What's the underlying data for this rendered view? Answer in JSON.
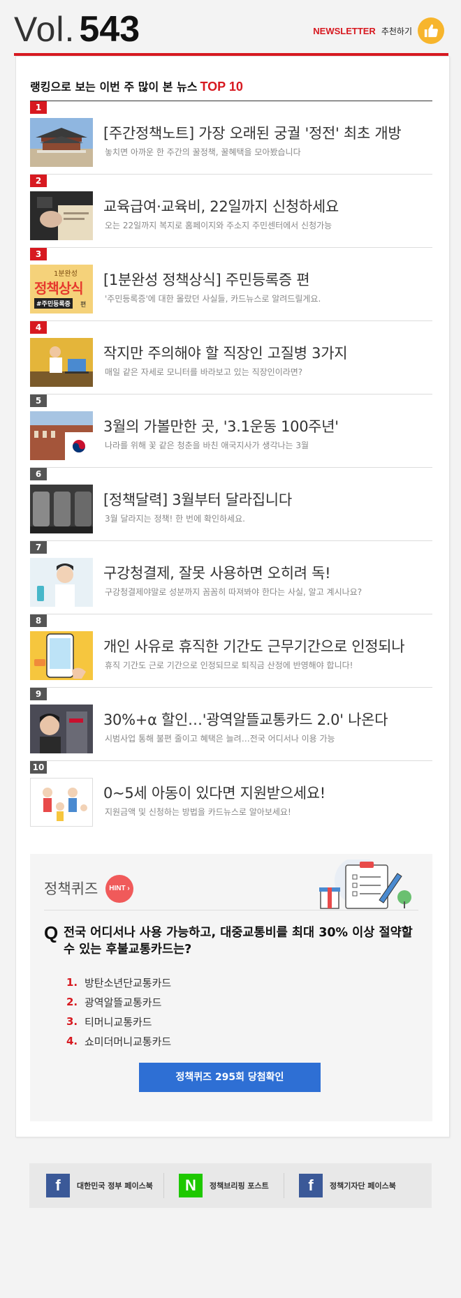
{
  "header": {
    "vol_label": "Vol.",
    "vol_number": "543",
    "newsletter_label": "NEWSLETTER",
    "recommend_label": "추천하기"
  },
  "ranking": {
    "title": "랭킹으로 보는 이번 주 많이 본 뉴스",
    "title_accent": "TOP 10",
    "items": [
      {
        "rank": "1",
        "title": "[주간정책노트] 가장 오래된 궁궐 '정전' 최초 개방",
        "subtitle": "놓치면 아까운 한 주간의 꿀정책, 꿀혜택을 모아봤습니다"
      },
      {
        "rank": "2",
        "title": "교육급여·교육비, 22일까지 신청하세요",
        "subtitle": "오는 22일까지 복지로 홈페이지와 주소지 주민센터에서 신청가능"
      },
      {
        "rank": "3",
        "title": "[1분완성 정책상식] 주민등록증 편",
        "subtitle": "'주민등록증'에 대한 몰랐던 사실들, 카드뉴스로 알려드릴게요.",
        "thumb_text_top": "1분완성",
        "thumb_text_main": "정책상식",
        "thumb_text_tag": "#주민등록증",
        "thumb_text_suffix": "편"
      },
      {
        "rank": "4",
        "title": "작지만 주의해야 할 직장인 고질병 3가지",
        "subtitle": "매일 같은 자세로 모니터를 바라보고 있는 직장인이라면?"
      },
      {
        "rank": "5",
        "title": "3월의 가볼만한 곳, '3.1운동 100주년'",
        "subtitle": "나라를 위해 꽃 같은 청춘을 바친 애국지사가 생각나는 3월"
      },
      {
        "rank": "6",
        "title": "[정책달력] 3월부터 달라집니다",
        "subtitle": "3월 달라지는 정책! 한 번에 확인하세요."
      },
      {
        "rank": "7",
        "title": "구강청결제, 잘못 사용하면 오히려 독!",
        "subtitle": "구강청결제야말로 성분까지 꼼꼼히 따져봐야 한다는 사실, 알고 계시나요?"
      },
      {
        "rank": "8",
        "title": "개인 사유로 휴직한 기간도 근무기간으로 인정되나",
        "subtitle": "휴직 기간도 근로 기간으로 인정되므로 퇴직금 산정에 반영해야 합니다!"
      },
      {
        "rank": "9",
        "title": "30%+α 할인…'광역알뜰교통카드 2.0' 나온다",
        "subtitle": "시범사업 통해 불편 줄이고 혜택은 늘려…전국 어디서나 이용 가능"
      },
      {
        "rank": "10",
        "title": "0~5세 아동이 있다면 지원받으세요!",
        "subtitle": "지원금액 및 신청하는 방법을 카드뉴스로 알아보세요!"
      }
    ]
  },
  "quiz": {
    "title": "정책퀴즈",
    "hint_label": "HINT ›",
    "question_mark": "Q",
    "question": "전국 어디서나 사용 가능하고, 대중교통비를 최대 30% 이상 절약할 수 있는 후불교통카드는?",
    "options": [
      {
        "num": "1.",
        "label": "방탄소년단교통카드"
      },
      {
        "num": "2.",
        "label": "광역알뜰교통카드"
      },
      {
        "num": "3.",
        "label": "티머니교통카드"
      },
      {
        "num": "4.",
        "label": "쇼미더머니교통카드"
      }
    ],
    "button_label": "정책퀴즈 295회 당첨확인"
  },
  "footer": {
    "links": [
      {
        "badge": "f",
        "label": "대한민국 정부 페이스북"
      },
      {
        "badge": "N",
        "label": "정책브리핑 포스트"
      },
      {
        "badge": "f",
        "label": "정책기자단 페이스북"
      }
    ]
  },
  "colors": {
    "accent_red": "#d71920",
    "quiz_button_blue": "#2e6fd4",
    "facebook_blue": "#3b5998",
    "naver_green": "#1ec800",
    "hint_red": "#f05a5a"
  }
}
